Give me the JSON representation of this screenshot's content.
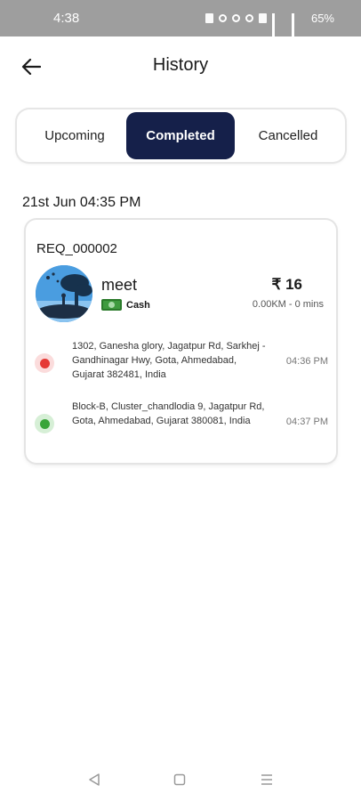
{
  "status_bar": {
    "time": "4:38",
    "battery": "65%"
  },
  "header": {
    "title": "History"
  },
  "tabs": [
    {
      "label": "Upcoming",
      "active": false
    },
    {
      "label": "Completed",
      "active": true
    },
    {
      "label": "Cancelled",
      "active": false
    }
  ],
  "ride": {
    "date": "21st Jun 04:35 PM",
    "request_id": "REQ_000002",
    "rider_name": "meet",
    "payment_method": "Cash",
    "fare": "₹ 16",
    "distance_duration": "0.00KM - 0 mins",
    "pickup": {
      "address": "1302, Ganesha glory, Jagatpur Rd, Sarkhej - Gandhinagar Hwy, Gota, Ahmedabad, Gujarat 382481, India",
      "time": "04:36 PM"
    },
    "drop": {
      "address": "Block-B, Cluster_chandlodia 9, Jagatpur Rd, Gota, Ahmedabad, Gujarat 380081, India",
      "time": "04:37 PM"
    }
  },
  "colors": {
    "active_tab": "#15204a",
    "pickup_dot": "#e53935",
    "drop_dot": "#3aa53a",
    "status_bar": "#9e9e9e"
  },
  "icons": [
    "back-arrow-icon",
    "cash-icon",
    "nav-back-icon",
    "nav-home-icon",
    "nav-recent-icon"
  ]
}
